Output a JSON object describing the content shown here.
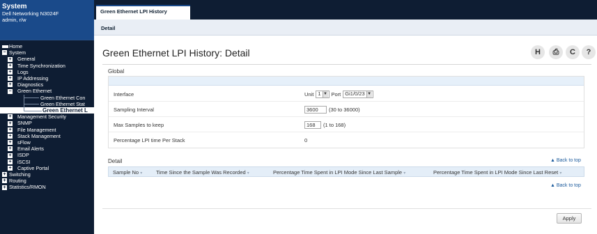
{
  "sidebar": {
    "app_title": "System",
    "device": "Dell Networking N3024F",
    "user": "admin, r/w",
    "tree": [
      {
        "label": "Home",
        "level": 0,
        "toggle": "icon"
      },
      {
        "label": "System",
        "level": 0,
        "toggle": "−"
      },
      {
        "label": "General",
        "level": 1,
        "toggle": "+"
      },
      {
        "label": "Time Synchronization",
        "level": 1,
        "toggle": "+"
      },
      {
        "label": "Logs",
        "level": 1,
        "toggle": "+"
      },
      {
        "label": "IP Addressing",
        "level": 1,
        "toggle": "+"
      },
      {
        "label": "Diagnostics",
        "level": 1,
        "toggle": "+"
      },
      {
        "label": "Green Ethernet",
        "level": 1,
        "toggle": "−"
      },
      {
        "label": "Green Ethernet Con",
        "level": 2,
        "toggle": ""
      },
      {
        "label": "Green Ethernet Stat",
        "level": 2,
        "toggle": ""
      },
      {
        "label": "Green Ethernet L",
        "level": 2,
        "toggle": "",
        "selected": true
      },
      {
        "label": "Management Security",
        "level": 1,
        "toggle": "+"
      },
      {
        "label": "SNMP",
        "level": 1,
        "toggle": "+"
      },
      {
        "label": "File Management",
        "level": 1,
        "toggle": "+"
      },
      {
        "label": "Stack Management",
        "level": 1,
        "toggle": "+"
      },
      {
        "label": "sFlow",
        "level": 1,
        "toggle": "+"
      },
      {
        "label": "Email Alerts",
        "level": 1,
        "toggle": "+"
      },
      {
        "label": "ISDP",
        "level": 1,
        "toggle": "+"
      },
      {
        "label": "iSCSI",
        "level": 1,
        "toggle": "+"
      },
      {
        "label": "Captive Portal",
        "level": 1,
        "toggle": "+"
      },
      {
        "label": "Switching",
        "level": 0,
        "toggle": "+"
      },
      {
        "label": "Routing",
        "level": 0,
        "toggle": "+"
      },
      {
        "label": "Statistics/RMON",
        "level": 0,
        "toggle": "+"
      }
    ]
  },
  "top_tab": "Green Ethernet LPI History",
  "sub_tab": "Detail",
  "page_title": "Green Ethernet LPI History: Detail",
  "header_icons": [
    {
      "name": "help-book-icon",
      "glyph": "H"
    },
    {
      "name": "print-icon",
      "glyph": "⎙"
    },
    {
      "name": "refresh-icon",
      "glyph": "C"
    },
    {
      "name": "help-icon",
      "glyph": "?"
    }
  ],
  "global": {
    "section_label": "Global",
    "interface_label": "Interface",
    "unit_label": "Unit",
    "unit_value": "1",
    "port_label": "Port",
    "port_value": "Gi1/0/23",
    "sampling_label": "Sampling Interval",
    "sampling_value": "3600",
    "sampling_range": "(30 to 36000)",
    "max_label": "Max Samples to keep",
    "max_value": "168",
    "max_range": "(1 to 168)",
    "pct_label": "Percentage LPI time Per Stack",
    "pct_value": "0"
  },
  "detail": {
    "section_label": "Detail",
    "back_to_top": "▲ Back to top",
    "columns": [
      "Sample No",
      "Time Since the Sample Was Recorded",
      "Percentage Time Spent in LPI Mode Since Last Sample",
      "Percentage Time Spent in LPI Mode Since Last Reset"
    ]
  },
  "apply_label": "Apply",
  "colors": {
    "sidebar_bg": "#0e1d33",
    "header_blue": "#1a4a8a",
    "table_header": "#e4eef8",
    "link": "#1b5a9c"
  }
}
